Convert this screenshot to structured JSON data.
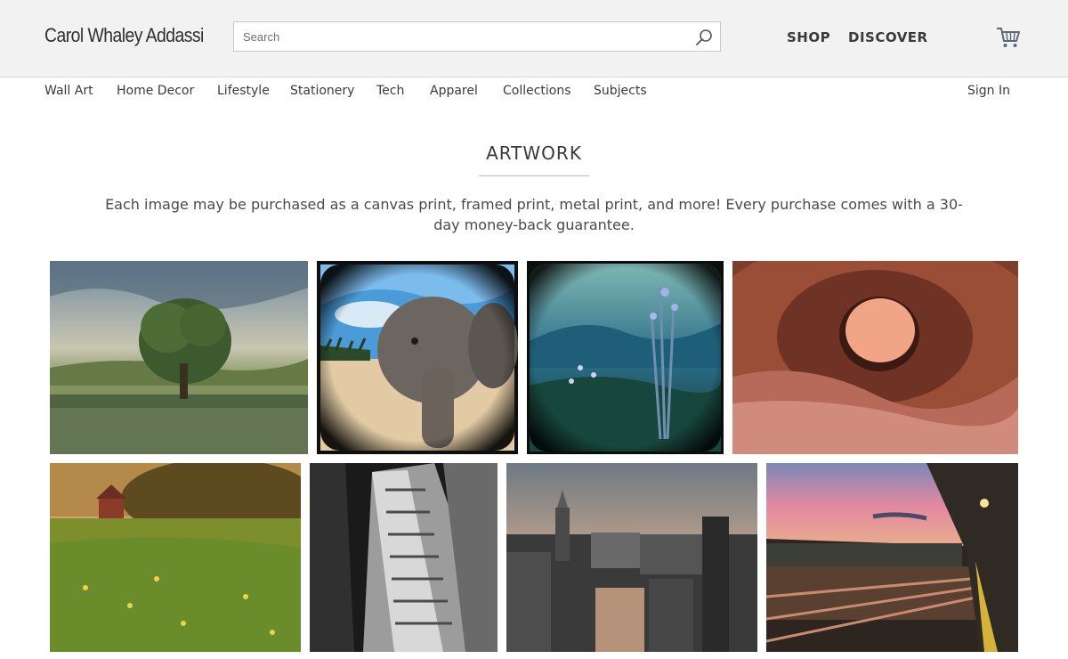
{
  "brand": "Carol Whaley Addassi",
  "search": {
    "placeholder": "Search"
  },
  "topnav": {
    "shop": "SHOP",
    "discover": "DISCOVER"
  },
  "categories": [
    "Wall Art",
    "Home Decor",
    "Lifestyle",
    "Stationery",
    "Tech",
    "Apparel",
    "Collections",
    "Subjects"
  ],
  "sign_in": "Sign In",
  "section": {
    "title": "ARTWORK",
    "intro": "Each image may be purchased as a canvas print, framed print, metal print, and more! Every purchase comes with a 30-day money-back guarantee."
  },
  "icons": {
    "search": "search-icon",
    "cart": "cart-icon"
  },
  "colors": {
    "header_bg": "#f2f2f2",
    "text": "#3a3a3a"
  }
}
